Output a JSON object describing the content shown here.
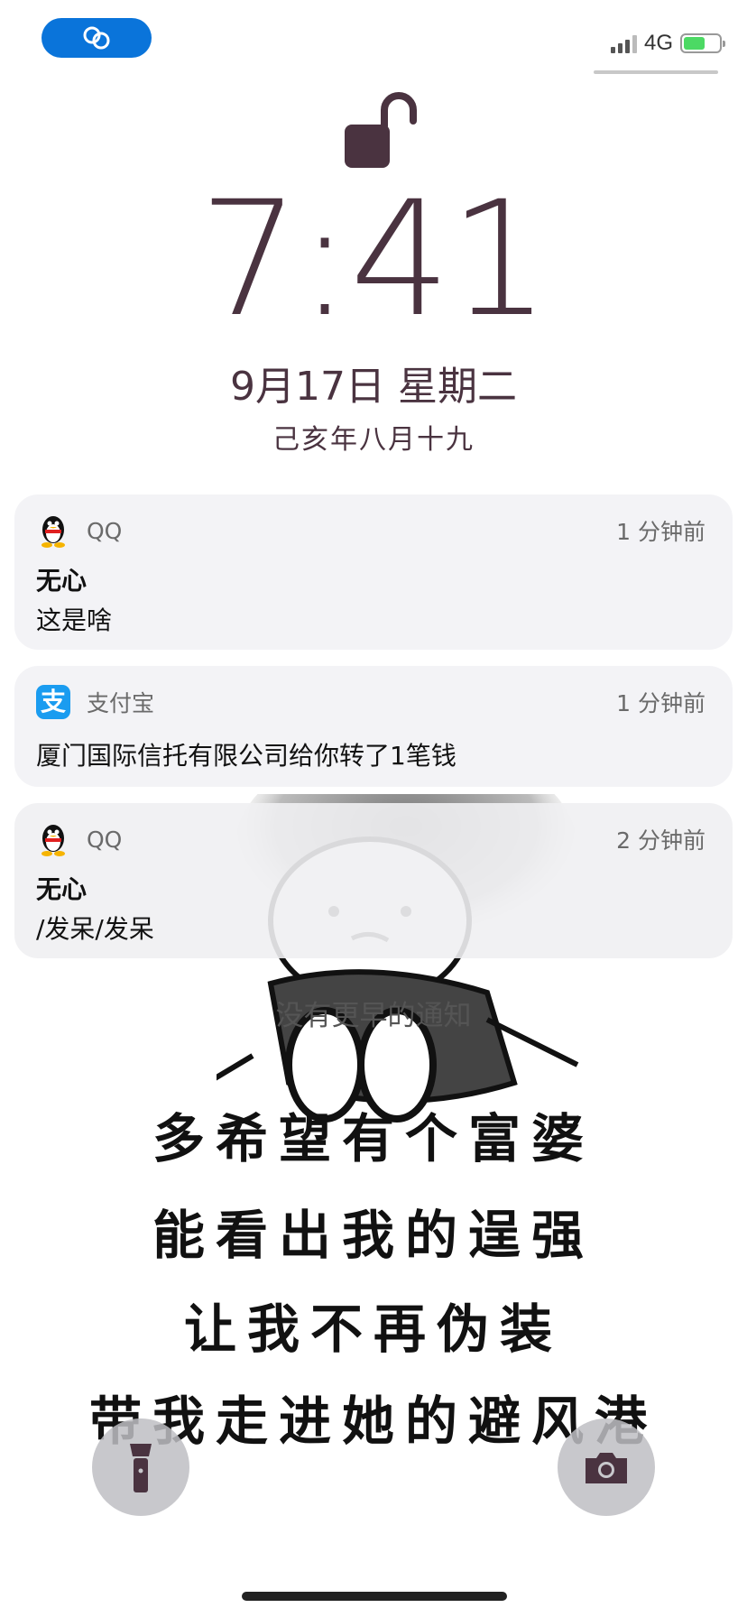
{
  "status_bar": {
    "network": "4G",
    "battery_color": "#4cd964",
    "pill_color": "#0a74da",
    "pill_icon": "link-icon"
  },
  "lockscreen": {
    "lock_icon": "unlocked-padlock-icon",
    "time": "7:41",
    "date": "9月17日 星期二",
    "lunar_date": "己亥年八月十九",
    "text_color": "#4a3340"
  },
  "notifications": [
    {
      "app": "QQ",
      "icon": "qq-penguin-icon",
      "time": "1 分钟前",
      "title": "无心",
      "body": "这是啥"
    },
    {
      "app": "支付宝",
      "icon": "alipay-icon",
      "time": "1 分钟前",
      "title": "",
      "body": "厦门国际信托有限公司给你转了1笔钱"
    },
    {
      "app": "QQ",
      "icon": "qq-penguin-icon",
      "time": "2 分钟前",
      "title": "无心",
      "body": "/发呆/发呆"
    }
  ],
  "no_earlier": "没有更早的通知",
  "wallpaper": {
    "lines": [
      "多希望有个富婆",
      "能看出我的逞强",
      "让我不再伪装",
      "带我走进她的避风港"
    ]
  },
  "bottom": {
    "flashlight_icon": "flashlight-icon",
    "camera_icon": "camera-icon"
  }
}
